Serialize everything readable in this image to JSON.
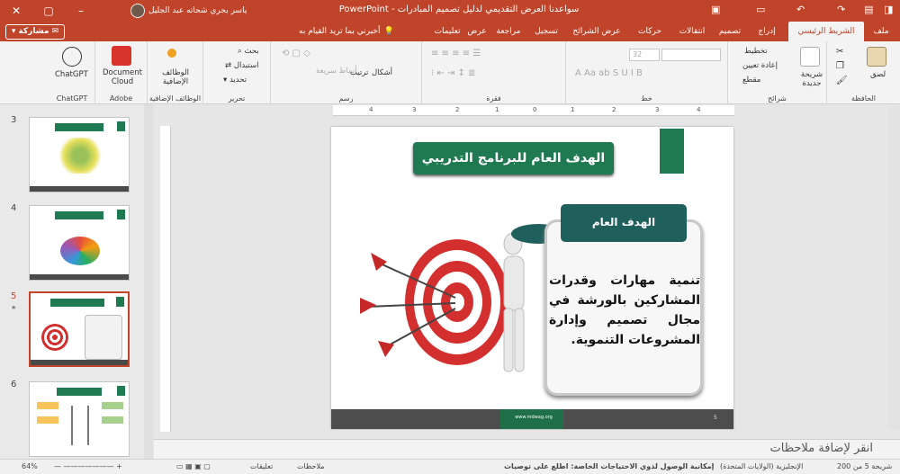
{
  "window": {
    "title": "PowerPoint - سواعدنا العرض التقديمي لدليل تصميم المبادرات",
    "user": "ياسر بحري شحاته عبد الجليل",
    "minimize": "–",
    "maximize": "▢",
    "close": "✕"
  },
  "tabs": {
    "file": "ملف",
    "home": "الشريط الرئيسي",
    "insert": "إدراج",
    "design": "تصميم",
    "transitions": "انتقالات",
    "animations": "حركات",
    "slideshow": "عرض الشرائح",
    "record": "تسجيل",
    "review": "مراجعة",
    "view": "عرض",
    "help": "تعليمات",
    "tellme": "أخبرني بما تريد القيام به",
    "share": "مشاركة"
  },
  "ribbon": {
    "clipboard": {
      "label": "الحافظة",
      "paste": "لصق"
    },
    "slides": {
      "label": "شرائح",
      "new_slide": "شريحة جديدة",
      "layout": "تخطيط",
      "reset": "إعادة تعيين",
      "section": "مقطع"
    },
    "font": {
      "label": "خط",
      "size": "32"
    },
    "paragraph": {
      "label": "فقرة"
    },
    "drawing": {
      "label": "رسم",
      "shapes": "أشكال",
      "arrange": "ترتيب",
      "styles": "أنماط سريعة"
    },
    "editing": {
      "label": "تحرير",
      "find": "بحث",
      "replace": "استبدال",
      "select": "تحديد"
    },
    "addins": {
      "label": "الوظائف الإضافية",
      "btn": "الوظائف الإضافية"
    },
    "adobe": {
      "label": "Adobe",
      "btn": "Document Cloud"
    },
    "chatgpt": {
      "label": "ChatGPT",
      "btn": "ChatGPT"
    }
  },
  "thumbnails": [
    {
      "num": "3",
      "title": "مقدمة تعريفية"
    },
    {
      "num": "4",
      "title": "توقعات المشاركين"
    },
    {
      "num": "5",
      "title": "الهدف العام للبرنامج التدريبي",
      "star": "★"
    },
    {
      "num": "6",
      "title": "الهدف من المقرر"
    }
  ],
  "ruler": [
    "4",
    "3",
    "2",
    "1",
    "0",
    "1",
    "2",
    "3",
    "4"
  ],
  "slide": {
    "title": "الهدف العام للبرنامج التدريبي",
    "puzzle_head": "الهدف العام",
    "body": "تنمية مهارات وقدرات المشاركين بالورشة في مجال تصميم وإدارة المشروعات التنموية.",
    "footer_url": "www.mdwag.org"
  },
  "notes": {
    "placeholder": "انقر لإضافة ملاحظات"
  },
  "status": {
    "slide": "شريحة 5 من 200",
    "language": "الإنجليزية (الولايات المتحدة)",
    "accessibility": "إمكانية الوصول لذوي الاحتياجات الخاصة: اطلع على توصيات",
    "notes": "ملاحظات",
    "comments": "تعليقات",
    "zoom": "64%"
  },
  "colors": {
    "brand": "#c0442a",
    "slide_green": "#1f7a52",
    "target_red": "#d32f2f"
  }
}
